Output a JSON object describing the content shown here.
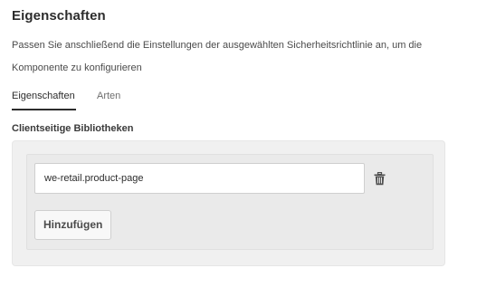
{
  "dialog": {
    "title": "Eigenschaften",
    "description_line1": "Passen Sie anschließend die Einstellungen der ausgewählten Sicherheitsrichtlinie an, um die",
    "description_line2": "Komponente zu konfigurieren"
  },
  "tabs": [
    {
      "label": "Eigenschaften",
      "active": true
    },
    {
      "label": "Arten",
      "active": false
    }
  ],
  "client_libraries": {
    "label": "Clientseitige Bibliotheken",
    "items": [
      {
        "value": "we-retail.product-page",
        "remove_icon": "trash-icon"
      }
    ],
    "add_label": "Hinzufügen"
  },
  "colors": {
    "text": "#2c2c2c",
    "panel_bg": "#f0f0f0",
    "tab_underline": "#2c2c2c"
  }
}
